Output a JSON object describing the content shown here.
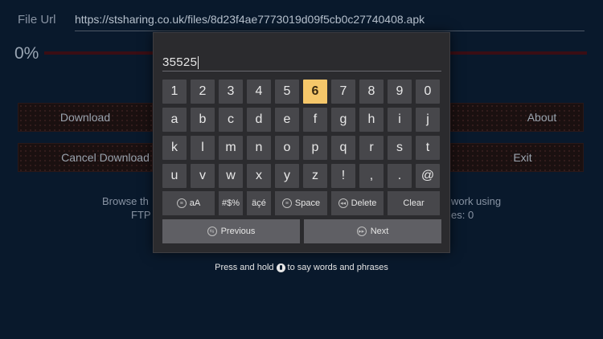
{
  "background": {
    "file_url_label": "File Url",
    "file_url_value": "https://stsharing.co.uk/files/8d23f4ae7773019d09f5cb0c27740408.apk",
    "progress_percent": 0,
    "progress_label": "0%",
    "buttons": {
      "download": "Download",
      "about": "About",
      "cancel_download": "Cancel Download",
      "exit": "Exit"
    },
    "info_left": [
      "Browse th",
      "FTP"
    ],
    "info_right": [
      "work using",
      "es: 0"
    ]
  },
  "keyboard": {
    "input_value": "35525",
    "rows": [
      [
        "1",
        "2",
        "3",
        "4",
        "5",
        "6",
        "7",
        "8",
        "9",
        "0"
      ],
      [
        "a",
        "b",
        "c",
        "d",
        "e",
        "f",
        "g",
        "h",
        "i",
        "j"
      ],
      [
        "k",
        "l",
        "m",
        "n",
        "o",
        "p",
        "q",
        "r",
        "s",
        "t"
      ],
      [
        "u",
        "v",
        "w",
        "x",
        "y",
        "z",
        "!",
        ",",
        ".",
        "@"
      ]
    ],
    "focused_key": "6",
    "function_keys": {
      "case_icon_glyph": "≡",
      "case_label": "aA",
      "symbols": "#$%",
      "accents": "äçé",
      "space_icon_glyph": "≡",
      "space": "Space",
      "delete_icon_glyph": "◂◂",
      "delete": "Delete",
      "clear": "Clear"
    },
    "previous_icon_glyph": "⇆",
    "previous": "Previous",
    "next_icon_glyph": "▸▸",
    "next": "Next"
  },
  "hint": {
    "before": "Press and hold",
    "after": "to say words and phrases"
  },
  "colors": {
    "background": "#09192c",
    "keyboard_panel": "#2b2b2e",
    "key": "#47474b",
    "focused_key": "#f5c76a",
    "progress": "#8d1a20"
  }
}
